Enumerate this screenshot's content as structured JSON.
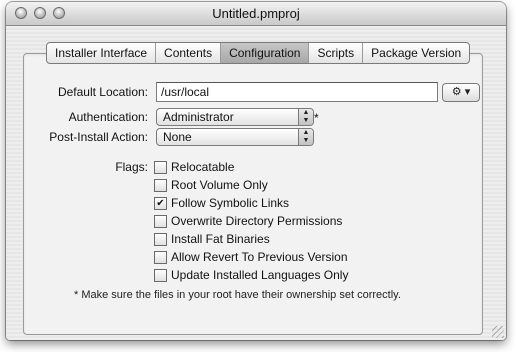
{
  "window": {
    "title": "Untitled.pmproj"
  },
  "tabs": [
    {
      "label": "Installer Interface",
      "selected": false
    },
    {
      "label": "Contents",
      "selected": false
    },
    {
      "label": "Configuration",
      "selected": true
    },
    {
      "label": "Scripts",
      "selected": false
    },
    {
      "label": "Package Version",
      "selected": false
    }
  ],
  "form": {
    "default_location_label": "Default Location:",
    "default_location_value": "/usr/local",
    "action_menu_icon": "gear-icon",
    "authentication_label": "Authentication:",
    "authentication_value": "Administrator",
    "authentication_asterisk": "*",
    "post_install_label": "Post-Install Action:",
    "post_install_value": "None",
    "flags_label": "Flags:"
  },
  "flags": [
    {
      "label": "Relocatable",
      "checked": false
    },
    {
      "label": "Root Volume Only",
      "checked": false
    },
    {
      "label": "Follow Symbolic Links",
      "checked": true
    },
    {
      "label": "Overwrite Directory Permissions",
      "checked": false
    },
    {
      "label": "Install Fat Binaries",
      "checked": false
    },
    {
      "label": "Allow Revert To Previous Version",
      "checked": false
    },
    {
      "label": "Update Installed Languages Only",
      "checked": false
    }
  ],
  "note": "* Make sure the files in your root have their ownership set correctly."
}
